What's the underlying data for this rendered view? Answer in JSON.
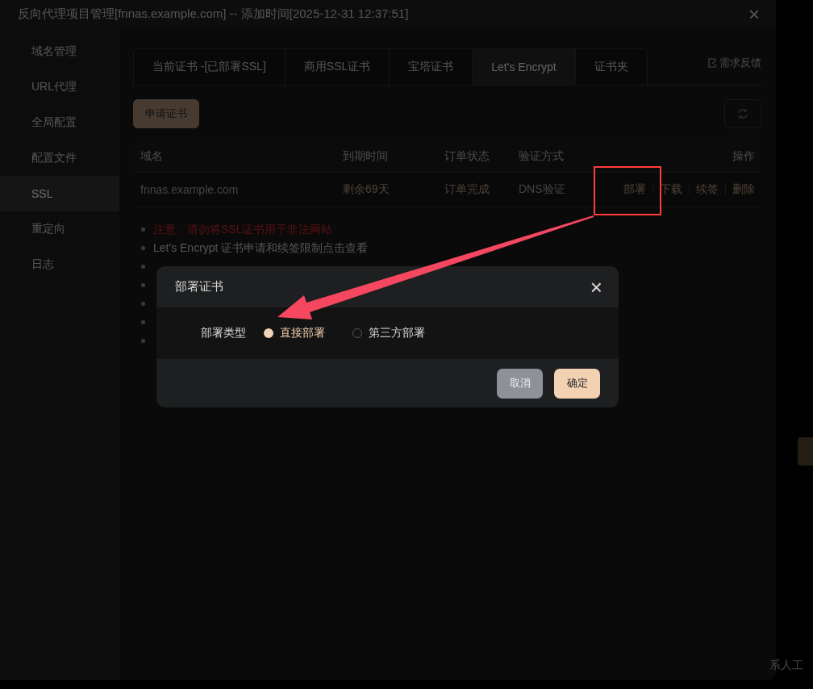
{
  "window": {
    "title": "反向代理项目管理[fnnas.example.com] -- 添加时间[2025-12-31 12:37:51]",
    "close": "×"
  },
  "sidebar": {
    "items": [
      {
        "label": "域名管理",
        "selected": false
      },
      {
        "label": "URL代理",
        "selected": false
      },
      {
        "label": "全局配置",
        "selected": false
      },
      {
        "label": "配置文件",
        "selected": false
      },
      {
        "label": "SSL",
        "selected": true
      },
      {
        "label": "重定向",
        "selected": false
      },
      {
        "label": "日志",
        "selected": false
      }
    ]
  },
  "tabs": [
    {
      "label": "当前证书 -[已部署SSL]",
      "selected": false
    },
    {
      "label": "商用SSL证书",
      "selected": false
    },
    {
      "label": "宝塔证书",
      "selected": false
    },
    {
      "label": "Let's Encrypt",
      "selected": true
    },
    {
      "label": "证书夹",
      "selected": false
    }
  ],
  "feedback": "需求反馈",
  "apply_button": "申请证书",
  "table": {
    "columns": [
      "域名",
      "到期时间",
      "订单状态",
      "验证方式",
      "操作"
    ],
    "rows": [
      {
        "domain": "fnnas.example.com",
        "expiry": "剩余69天",
        "status": "订单完成",
        "verify": "DNS验证",
        "actions": [
          "部署",
          "下载",
          "续签",
          "删除"
        ]
      }
    ]
  },
  "notes": [
    {
      "text": "注意：请勿将SSL证书用于非法网站",
      "kind": "warning"
    },
    {
      "text": "Let's Encrypt 证书申请和续签限制点击查看",
      "kind": "normal"
    },
    {
      "kind": "hidden"
    },
    {
      "kind": "hidden"
    },
    {
      "kind": "hidden"
    },
    {
      "kind": "hidden"
    },
    {
      "kind": "hidden"
    }
  ],
  "background_text": "系人工",
  "dialog": {
    "title": "部署证书",
    "close": "×",
    "field_label": "部署类型",
    "options": [
      {
        "label": "直接部署",
        "selected": true
      },
      {
        "label": "第三方部署",
        "selected": false
      }
    ],
    "buttons": [
      {
        "label": "取消",
        "kind": "secondary"
      },
      {
        "label": "确定",
        "kind": "primary"
      }
    ]
  }
}
